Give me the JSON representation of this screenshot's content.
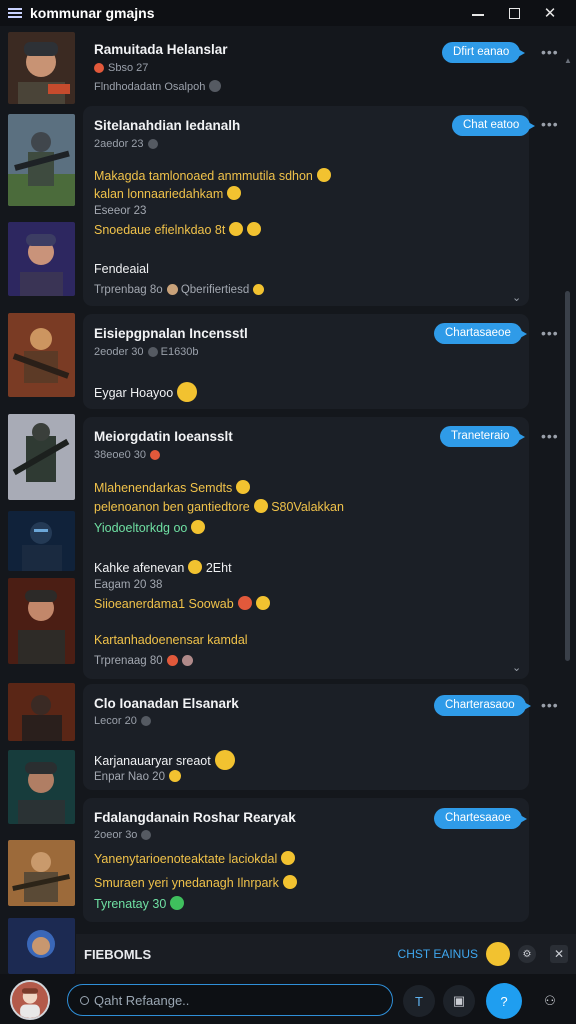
{
  "window": {
    "title": "kommunar gmajns",
    "minimize_icon": "minimize-icon",
    "maximize_icon": "maximize-icon",
    "close_icon": "close-icon"
  },
  "colors": {
    "accent": "#2f9be8",
    "background": "#14171c",
    "card": "#1b1f26",
    "gold_text": "#f0c24a",
    "green_text": "#6fe0a3"
  },
  "posts": [
    {
      "name": "Ramuitada Helanslar",
      "meta": "Sbso 27",
      "subline": "Flndhodadatn Osalpoh",
      "action": "Dfirt eanao",
      "lines": []
    },
    {
      "name": "Sitelanahdian Iedanalh",
      "meta": "2aedor 23",
      "action": "Chat eatoo",
      "lines": [
        {
          "text": "Makagda tamlonoaed anmmutila sdhon",
          "style": "gold"
        },
        {
          "text": "kalan lonnaariedahkam",
          "style": "gold"
        },
        {
          "text": "Eseeor 23",
          "style": "grey"
        },
        {
          "text": "Snoedaue efielnkdao 8t",
          "style": "gold"
        },
        {
          "text": "Fendeaial",
          "style": "white"
        },
        {
          "text": "Trprenbag 8o",
          "style": "grey"
        },
        {
          "text": "Qberifiertiesd",
          "style": "grey"
        }
      ]
    },
    {
      "name": "Eisiepgpnalan Incensstl",
      "meta": "2eoder 30",
      "meta_extra": "E1630b",
      "action": "Chartasaeoe",
      "lines": [
        {
          "text": "Eygar Hoayoo",
          "style": "white"
        }
      ]
    },
    {
      "name": "Meiorgdatin Ioeansslt",
      "meta": "38eoe0 30",
      "action": "Traneteraio",
      "lines": [
        {
          "text": "Mlahenendarkas Semdts",
          "style": "gold"
        },
        {
          "text": "pelenoanon ben gantiedtore",
          "style": "gold"
        },
        {
          "text": "S80Valakkan",
          "style": "gold"
        },
        {
          "text": "Yiodoeltorkdg oo",
          "style": "green"
        },
        {
          "text": "Kahke afenevan",
          "style": "white"
        },
        {
          "text": "2Eht",
          "style": "white"
        },
        {
          "text": "Eagam 20 38",
          "style": "grey"
        },
        {
          "text": "Siioeanerdama1 Soowab",
          "style": "gold"
        },
        {
          "text": "Kartanhadoenensar kamdal",
          "style": "gold"
        },
        {
          "text": "Trprenaag 80",
          "style": "grey"
        }
      ]
    },
    {
      "name": "Clo Ioanadan Elsanark",
      "meta": "Lecor 20",
      "action": "Charterasaoo",
      "lines": [
        {
          "text": "Karjanauaryar sreaot",
          "style": "white"
        },
        {
          "text": "Enpar Nao 20",
          "style": "grey"
        }
      ]
    },
    {
      "name": "Fdalangdanain Roshar Rearyak",
      "meta": "2oeor 3o",
      "action": "Chartesaaoe",
      "lines": [
        {
          "text": "Yanenytarioenoteaktate laciokdal",
          "style": "gold"
        },
        {
          "text": "Smuraen yeri ynedanagh Ilnrpark",
          "style": "gold"
        },
        {
          "text": "Tyrenatay 30",
          "style": "green"
        }
      ]
    }
  ],
  "notification": {
    "title": "FIEBOMLS",
    "action": "CHST EAINUS"
  },
  "composer": {
    "search_placeholder": "Qaht Refaange.."
  },
  "avatars": [
    "avatar-1",
    "avatar-2",
    "avatar-3",
    "avatar-4",
    "avatar-5",
    "avatar-6",
    "avatar-7",
    "avatar-8",
    "avatar-9",
    "avatar-10",
    "avatar-11",
    "avatar-12",
    "avatar-13",
    "avatar-14"
  ]
}
